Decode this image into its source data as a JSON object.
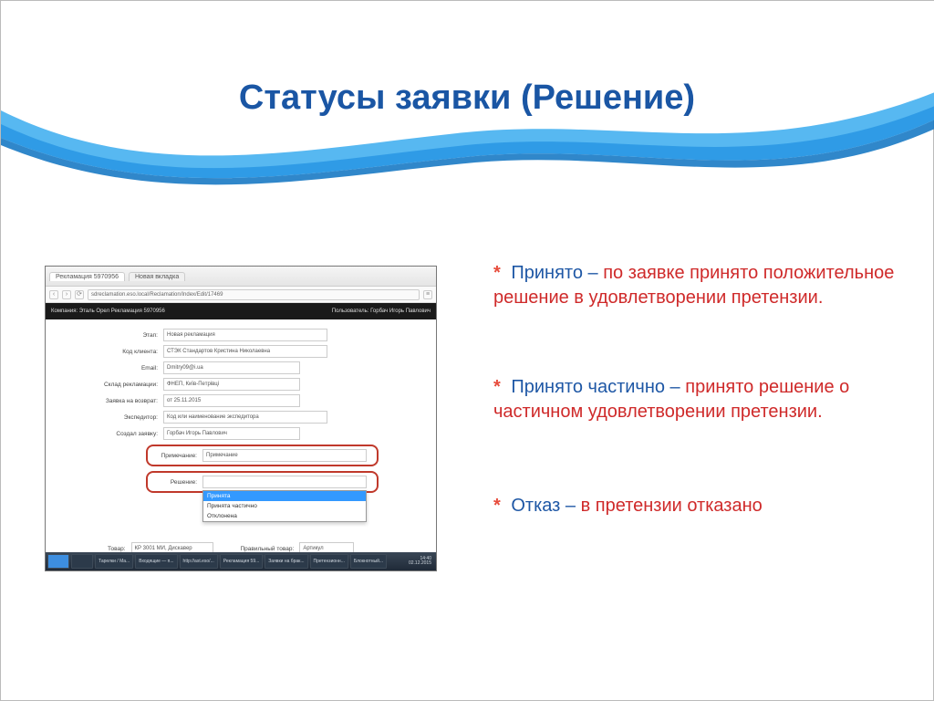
{
  "title": "Статусы заявки (Решение)",
  "bullets": {
    "b1": {
      "term": "Принято",
      "desc": "по заявке принято положительное решение в удовлетворении претензии."
    },
    "b2": {
      "term": "Принято частично",
      "desc": "принято решение о частичном удовлетворении претензии."
    },
    "b3": {
      "term": "Отказ",
      "desc": "в претензии отказано"
    }
  },
  "screenshot": {
    "tab1": "Рекламация 5970956",
    "tab2": "Новая вкладка",
    "url": "sdreclamation.eso.local/Reclamation/Index/Edit/17469",
    "blackLeft": "Компания: Эталь Орел     Рекламация 5970956",
    "blackRight": "Пользователь: Горбач Игорь Павлович",
    "rows": {
      "r1": {
        "label": "Этап:",
        "value": "Новая рекламация"
      },
      "r2": {
        "label": "Код клиента:",
        "value": "СТЭК  Стандартов Кристина Николаевна"
      },
      "r3": {
        "label": "Email:",
        "value": "Dmitry09@i.ua"
      },
      "r4": {
        "label": "Склад рекламации:",
        "value": "ФНЕП, Київ-Петрівці"
      },
      "r5": {
        "label": "Заявка на возврат:",
        "value": "от 25.11.2015"
      },
      "r6": {
        "label": "Экспедитор:",
        "value": "Код или наименование экспедитора"
      },
      "r7": {
        "label": "Создал заявку:",
        "value": "Горбач Игорь Павлович"
      }
    },
    "boxed1": {
      "label": "Примечание:",
      "value": "Примечание"
    },
    "boxed2": {
      "label": "Решение:",
      "value": ""
    },
    "dropdown": {
      "o1": "Принята",
      "o2": "Принята частично",
      "o3": "Отклонена"
    },
    "bottom": {
      "l1": "Товар:",
      "v1": "КР 3001 МИ, Дискавер",
      "l2": "Правильный товар:",
      "v2": "Артикул"
    },
    "taskbar": {
      "b1": "Тарелки / Ma...",
      "b2": "Входящие — п...",
      "b3": "http://ast.eso/...",
      "b4": "Рекламация 59...",
      "b5": "Заявки на брак...",
      "b6": "Претензионн...",
      "b7": "Блокнотный...",
      "time": "14:40",
      "date": "02.12.2015"
    }
  }
}
